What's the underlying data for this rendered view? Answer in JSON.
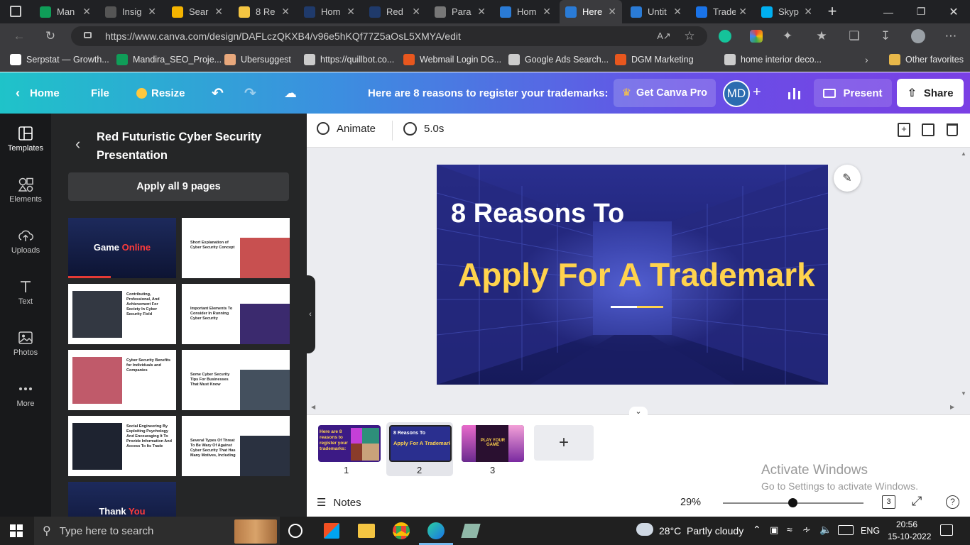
{
  "browser": {
    "tabs": [
      {
        "title": "Man",
        "color": "#0f9d58"
      },
      {
        "title": "Insig",
        "color": "#555555"
      },
      {
        "title": "Sear",
        "color": "#f4b400"
      },
      {
        "title": "8 Re",
        "color": "#f4c542"
      },
      {
        "title": "Hom",
        "color": "#1f3a6b"
      },
      {
        "title": "Red",
        "color": "#1f3a6b"
      },
      {
        "title": "Para",
        "color": "#777777"
      },
      {
        "title": "Hom",
        "color": "#2a7bd6"
      },
      {
        "title": "Here",
        "color": "#2a7bd6"
      },
      {
        "title": "Untit",
        "color": "#2a7bd6"
      },
      {
        "title": "Trade",
        "color": "#1a73e8"
      },
      {
        "title": "Skyp",
        "color": "#00aff0"
      }
    ],
    "active_tab_index": 8,
    "url": "https://www.canva.com/design/DAFLczQKXB4/v96e5hKQf77Z5aOsL5XMYA/edit",
    "bookmarks": [
      {
        "label": "Serpstat — Growth...",
        "color": "#ffffff"
      },
      {
        "label": "Mandira_SEO_Proje...",
        "color": "#0f9d58"
      },
      {
        "label": "Ubersuggest",
        "color": "#e8a87c"
      },
      {
        "label": "https://quillbot.co...",
        "color": "#cccccc"
      },
      {
        "label": "Webmail Login DG...",
        "color": "#e8571e"
      },
      {
        "label": "Google Ads Search...",
        "color": "#cccccc"
      },
      {
        "label": "DGM Marketing",
        "color": "#e8571e"
      },
      {
        "label": "home interior deco...",
        "color": "#cccccc"
      }
    ],
    "other_favorites": "Other favorites"
  },
  "canva_bar": {
    "home": "Home",
    "file": "File",
    "resize": "Resize",
    "doc_title": "Here are 8 reasons to register your trademarks:",
    "get_pro": "Get Canva Pro",
    "avatar": "MD",
    "present": "Present",
    "share": "Share"
  },
  "rail": [
    {
      "label": "Templates",
      "icon": "templates-icon"
    },
    {
      "label": "Elements",
      "icon": "elements-icon"
    },
    {
      "label": "Uploads",
      "icon": "uploads-icon"
    },
    {
      "label": "Text",
      "icon": "text-icon"
    },
    {
      "label": "Photos",
      "icon": "photos-icon"
    },
    {
      "label": "More",
      "icon": "more-icon"
    }
  ],
  "panel": {
    "title": "Red Futuristic Cyber Security Presentation",
    "apply_all": "Apply all 9 pages",
    "templates": [
      {
        "kind": "dark",
        "text": "Game ",
        "accent": "Online"
      },
      {
        "kind": "light",
        "text": "Short Explanation of Cyber Security Concept"
      },
      {
        "kind": "light",
        "text": "Contributing, Professional, And Achievement For Society In Cyber Security Field"
      },
      {
        "kind": "light",
        "text": "Important Elements To Consider In Running Cyber Security"
      },
      {
        "kind": "light",
        "text": "Cyber Security Benefits for Individuals and Companies"
      },
      {
        "kind": "light",
        "text": "Some Cyber Security Tips For Businesses That Must Know"
      },
      {
        "kind": "light",
        "text": "Social Engineering By Exploiting Psychology And Encouraging It To Provide Information And Access To Its Trade"
      },
      {
        "kind": "light",
        "text": "Several Types Of Threat To Be Wary Of Against Cyber Security That Has Many Motives, Including"
      },
      {
        "kind": "dark",
        "text": "Thank ",
        "accent": "You"
      }
    ]
  },
  "toolbar": {
    "animate": "Animate",
    "duration": "5.0s"
  },
  "slide": {
    "line1": "8 Reasons To",
    "line2": "Apply For A Trademark"
  },
  "pages": [
    {
      "num": "1",
      "text": "Here are 8 reasons to register your trademarks:"
    },
    {
      "num": "2",
      "text_top": "8 Reasons To",
      "text_bottom": "Apply For A Trademark"
    },
    {
      "num": "3",
      "text": "PLAY YOUR GAME"
    }
  ],
  "footer": {
    "notes": "Notes",
    "zoom": "29%",
    "zoom_level": 0.29,
    "page_count": "3"
  },
  "watermark": {
    "line1": "Activate Windows",
    "line2": "Go to Settings to activate Windows."
  },
  "taskbar": {
    "search_placeholder": "Type here to search",
    "weather": "28°C  Partly cloudy",
    "lang": "ENG",
    "time": "20:56",
    "date": "15-10-2022"
  }
}
